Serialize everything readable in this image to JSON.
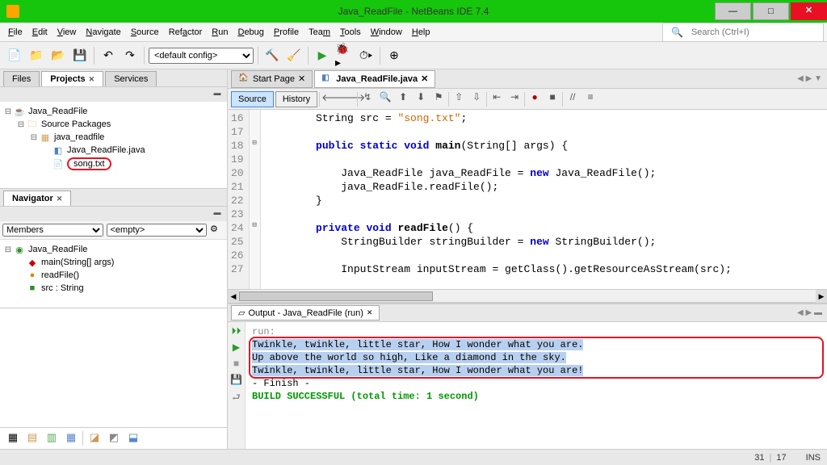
{
  "window": {
    "title": "Java_ReadFile - NetBeans IDE 7.4"
  },
  "menu": {
    "items": [
      "File",
      "Edit",
      "View",
      "Navigate",
      "Source",
      "Refactor",
      "Run",
      "Debug",
      "Profile",
      "Team",
      "Tools",
      "Window",
      "Help"
    ],
    "search_placeholder": "Search (Ctrl+I)"
  },
  "toolbar": {
    "config_label": "<default config>"
  },
  "left": {
    "tabs": [
      "Files",
      "Projects",
      "Services"
    ],
    "active_tab": 1,
    "project_tree": {
      "root": "Java_ReadFile",
      "src_packages": "Source Packages",
      "pkg": "java_readfile",
      "files": [
        "Java_ReadFile.java",
        "song.txt"
      ]
    },
    "navigator": {
      "title": "Navigator",
      "members_label": "Members",
      "empty_label": "<empty>",
      "class": "Java_ReadFile",
      "items": [
        {
          "icon": "◆",
          "color": "#c00",
          "text": "main(String[] args)"
        },
        {
          "icon": "●",
          "color": "#d48c00",
          "text": "readFile()"
        },
        {
          "icon": "■",
          "color": "#2a8c2a",
          "text": "src : String"
        }
      ]
    }
  },
  "editor": {
    "tabs": [
      {
        "label": "Start Page",
        "active": false
      },
      {
        "label": "Java_ReadFile.java",
        "active": true
      }
    ],
    "modes": [
      "Source",
      "History"
    ],
    "lines": [
      {
        "n": 16,
        "html": "        String src = <span class='str'>\"song.txt\"</span>;"
      },
      {
        "n": 17,
        "html": ""
      },
      {
        "n": 18,
        "html": "        <span class='kw'>public static void</span> <span class='method'>main</span>(String[] args) {",
        "fold": "⊟"
      },
      {
        "n": 19,
        "html": ""
      },
      {
        "n": 20,
        "html": "            Java_ReadFile java_ReadFile = <span class='kw'>new</span> Java_ReadFile();"
      },
      {
        "n": 21,
        "html": "            java_ReadFile.readFile();"
      },
      {
        "n": 22,
        "html": "        }"
      },
      {
        "n": 23,
        "html": ""
      },
      {
        "n": 24,
        "html": "        <span class='kw'>private void</span> <span class='method'>readFile</span>() {",
        "fold": "⊟"
      },
      {
        "n": 25,
        "html": "            StringBuilder stringBuilder = <span class='kw'>new</span> StringBuilder();"
      },
      {
        "n": 26,
        "html": ""
      },
      {
        "n": 27,
        "html": "            InputStream inputStream = getClass().getResourceAsStream(src);"
      }
    ]
  },
  "output": {
    "tab_label": "Output - Java_ReadFile (run)",
    "lines": [
      {
        "text": "run:",
        "cls": "out-gray"
      },
      {
        "text": "Twinkle, twinkle, little star, How I wonder what you are.",
        "cls": "out-black out-highlight",
        "hi": true
      },
      {
        "text": "Up above the world so high, Like a diamond in the sky.",
        "cls": "out-black out-highlight",
        "hi": true
      },
      {
        "text": "Twinkle, twinkle, little star, How I wonder what you are!",
        "cls": "out-black out-highlight",
        "hi": true
      },
      {
        "text": "- Finish -",
        "cls": "out-black"
      },
      {
        "text": "BUILD SUCCESSFUL (total time: 1 second)",
        "cls": "out-green"
      }
    ]
  },
  "status": {
    "line": "31",
    "col": "17",
    "mode": "INS"
  }
}
